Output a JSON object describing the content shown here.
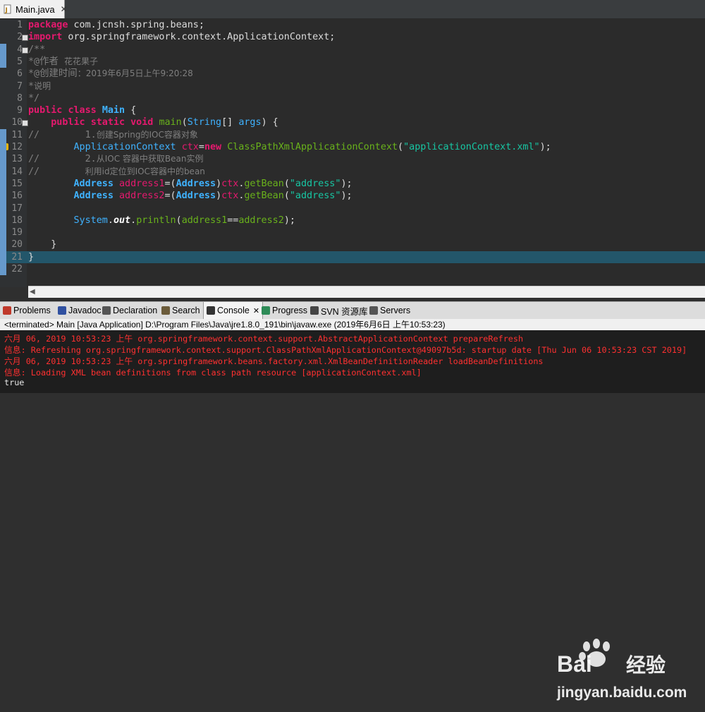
{
  "editor": {
    "tab": {
      "icon": "java-file-icon",
      "label": "Main.java",
      "close": "✕"
    }
  },
  "code": {
    "lines": [
      {
        "n": "1",
        "tokens": [
          [
            "kw",
            "package"
          ],
          [
            "plain",
            " com.jcnsh.spring.beans;"
          ]
        ]
      },
      {
        "n": "2",
        "tokens": [
          [
            "kw",
            "import"
          ],
          [
            "plain",
            " org.springframework.context.ApplicationContext;"
          ]
        ],
        "fold": true
      },
      {
        "n": "4",
        "tokens": [
          [
            "cmt",
            "/**"
          ]
        ],
        "fold": true
      },
      {
        "n": "5",
        "tokens": [
          [
            "cmt",
            "*@作者 "
          ],
          [
            "cmt-cn",
            "花花果子"
          ]
        ]
      },
      {
        "n": "6",
        "tokens": [
          [
            "cmt",
            "*@创建时间"
          ],
          [
            "cmt-cn",
            "：2019年6月5日上午9:20:28"
          ]
        ]
      },
      {
        "n": "7",
        "tokens": [
          [
            "cmt",
            "*"
          ],
          [
            "cmt-cn",
            "说明"
          ]
        ]
      },
      {
        "n": "8",
        "tokens": [
          [
            "cmt",
            "*/"
          ]
        ]
      },
      {
        "n": "9",
        "tokens": [
          [
            "kw",
            "public"
          ],
          [
            "plain",
            " "
          ],
          [
            "kw",
            "class"
          ],
          [
            "plain",
            " "
          ],
          [
            "cls",
            "Main"
          ],
          [
            "plain",
            " {"
          ]
        ]
      },
      {
        "n": "10",
        "tokens": [
          [
            "plain",
            "    "
          ],
          [
            "kw",
            "public"
          ],
          [
            "plain",
            " "
          ],
          [
            "kw",
            "static"
          ],
          [
            "plain",
            " "
          ],
          [
            "kw",
            "void"
          ],
          [
            "plain",
            " "
          ],
          [
            "method",
            "main"
          ],
          [
            "plain",
            "("
          ],
          [
            "type",
            "String"
          ],
          [
            "plain",
            "[] "
          ],
          [
            "type",
            "args"
          ],
          [
            "plain",
            ") {"
          ]
        ],
        "fold": true
      },
      {
        "n": "11",
        "tokens": [
          [
            "cmt",
            "//        1."
          ],
          [
            "cmt-cn",
            "创建Spring的IOC容器对象"
          ]
        ]
      },
      {
        "n": "12",
        "tokens": [
          [
            "plain",
            "        "
          ],
          [
            "type",
            "ApplicationContext"
          ],
          [
            "plain",
            " "
          ],
          [
            "var",
            "ctx"
          ],
          [
            "plain",
            "="
          ],
          [
            "kw",
            "new"
          ],
          [
            "plain",
            " "
          ],
          [
            "method",
            "ClassPathXmlApplicationContext"
          ],
          [
            "plain",
            "("
          ],
          [
            "str",
            "\"applicationContext.xml\""
          ],
          [
            "plain",
            ");"
          ]
        ],
        "marker": true
      },
      {
        "n": "13",
        "tokens": [
          [
            "cmt",
            "//        2."
          ],
          [
            "cmt-cn",
            "从IOC 容器中获取Bean实例"
          ]
        ]
      },
      {
        "n": "14",
        "tokens": [
          [
            "cmt",
            "//        "
          ],
          [
            "cmt-cn",
            "利用id定位到IOC容器中的bean"
          ]
        ]
      },
      {
        "n": "15",
        "tokens": [
          [
            "plain",
            "        "
          ],
          [
            "cls",
            "Address"
          ],
          [
            "plain",
            " "
          ],
          [
            "var",
            "address1"
          ],
          [
            "plain",
            "=("
          ],
          [
            "cls",
            "Address"
          ],
          [
            "plain",
            ")"
          ],
          [
            "var",
            "ctx"
          ],
          [
            "plain",
            "."
          ],
          [
            "method",
            "getBean"
          ],
          [
            "plain",
            "("
          ],
          [
            "str",
            "\"address\""
          ],
          [
            "plain",
            ");"
          ]
        ]
      },
      {
        "n": "16",
        "tokens": [
          [
            "plain",
            "        "
          ],
          [
            "cls",
            "Address"
          ],
          [
            "plain",
            " "
          ],
          [
            "var",
            "address2"
          ],
          [
            "plain",
            "=("
          ],
          [
            "cls",
            "Address"
          ],
          [
            "plain",
            ")"
          ],
          [
            "var",
            "ctx"
          ],
          [
            "plain",
            "."
          ],
          [
            "method",
            "getBean"
          ],
          [
            "plain",
            "("
          ],
          [
            "str",
            "\"address\""
          ],
          [
            "plain",
            ");"
          ]
        ]
      },
      {
        "n": "17",
        "tokens": []
      },
      {
        "n": "18",
        "tokens": [
          [
            "plain",
            "        "
          ],
          [
            "type",
            "System"
          ],
          [
            "plain",
            "."
          ],
          [
            "field",
            "out"
          ],
          [
            "plain",
            "."
          ],
          [
            "method",
            "println"
          ],
          [
            "plain",
            "("
          ],
          [
            "method",
            "address1"
          ],
          [
            "plain",
            "=="
          ],
          [
            "method",
            "address2"
          ],
          [
            "plain",
            ");"
          ]
        ]
      },
      {
        "n": "19",
        "tokens": []
      },
      {
        "n": "20",
        "tokens": [
          [
            "plain",
            "    }"
          ]
        ]
      },
      {
        "n": "21",
        "tokens": [
          [
            "plain",
            "}"
          ]
        ],
        "current": true
      },
      {
        "n": "22",
        "tokens": []
      }
    ]
  },
  "views": {
    "tabs": [
      {
        "label": "Problems",
        "icon": "problems-icon",
        "color": "#c0392b"
      },
      {
        "label": "Javadoc",
        "icon": "javadoc-icon",
        "color": "#3050a0"
      },
      {
        "label": "Declaration",
        "icon": "declaration-icon",
        "color": "#555555"
      },
      {
        "label": "Search",
        "icon": "search-icon",
        "color": "#6b5b3a"
      },
      {
        "label": "Console",
        "icon": "console-icon",
        "color": "#333333",
        "active": true,
        "close": "✕"
      },
      {
        "label": "Progress",
        "icon": "progress-icon",
        "color": "#2e8b57"
      },
      {
        "label": "SVN 资源库",
        "icon": "svn-icon",
        "color": "#444444"
      },
      {
        "label": "Servers",
        "icon": "servers-icon",
        "color": "#555555"
      }
    ]
  },
  "console": {
    "header": "<terminated> Main [Java Application] D:\\Program Files\\Java\\jre1.8.0_191\\bin\\javaw.exe (2019年6月6日 上午10:53:23)",
    "lines": [
      {
        "text": "六月 06, 2019 10:53:23 上午 org.springframework.context.support.AbstractApplicationContext prepareRefresh",
        "type": "err"
      },
      {
        "text": "信息: Refreshing org.springframework.context.support.ClassPathXmlApplicationContext@49097b5d: startup date [Thu Jun 06 10:53:23 CST 2019]",
        "type": "err"
      },
      {
        "text": "六月 06, 2019 10:53:23 上午 org.springframework.beans.factory.xml.XmlBeanDefinitionReader loadBeanDefinitions",
        "type": "err"
      },
      {
        "text": "信息: Loading XML bean definitions from class path resource [applicationContext.xml]",
        "type": "err"
      },
      {
        "text": "true",
        "type": "out"
      }
    ]
  },
  "watermark": {
    "brand": "Bai",
    "brand2": "经验",
    "url": "jingyan.baidu.com"
  }
}
